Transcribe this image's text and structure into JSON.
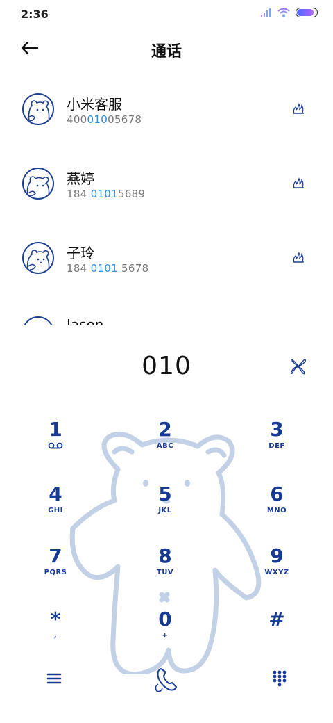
{
  "status_bar": {
    "time": "2:36",
    "icons": [
      "signal-icon",
      "wifi-icon",
      "battery-icon"
    ],
    "battery_fill_percent": 85
  },
  "header": {
    "title": "通话",
    "back_icon": "arrow-left-icon"
  },
  "contacts": [
    {
      "name": "小米客服",
      "number_parts": [
        "400",
        "010",
        "05678"
      ]
    },
    {
      "name": "燕婷",
      "number_parts": [
        "184 ",
        "0101",
        "5689"
      ]
    },
    {
      "name": "子玲",
      "number_parts": [
        "184 ",
        "0101",
        " 5678"
      ]
    },
    {
      "name": "Jason",
      "number_parts": [
        "",
        "",
        ""
      ]
    }
  ],
  "dialer": {
    "number": "010",
    "clear_icon": "clear-x-icon"
  },
  "keypad": {
    "keys": [
      {
        "digit": "1",
        "letters": ""
      },
      {
        "digit": "2",
        "letters": "ABC"
      },
      {
        "digit": "3",
        "letters": "DEF"
      },
      {
        "digit": "4",
        "letters": "GHI"
      },
      {
        "digit": "5",
        "letters": "JKL"
      },
      {
        "digit": "6",
        "letters": "MNO"
      },
      {
        "digit": "7",
        "letters": "PQRS"
      },
      {
        "digit": "8",
        "letters": "TUV"
      },
      {
        "digit": "9",
        "letters": "WXYZ"
      },
      {
        "digit": "*",
        "letters": ","
      },
      {
        "digit": "0",
        "letters": "+"
      },
      {
        "digit": "#",
        "letters": ""
      }
    ]
  },
  "bottom_bar": {
    "menu_icon": "menu-icon",
    "call_icon": "phone-call-icon",
    "keypad_icon": "keypad-grid-icon"
  },
  "colors": {
    "accent": "#173a93",
    "highlight": "#2a8be0",
    "bear": "#c3d1e6"
  }
}
